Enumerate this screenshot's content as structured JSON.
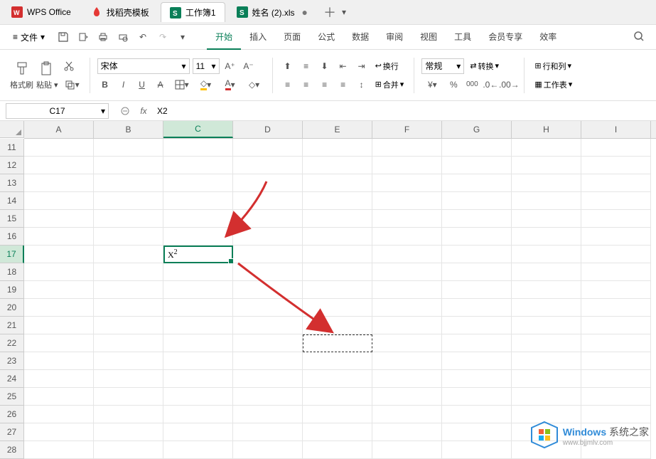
{
  "topTabs": {
    "t1": {
      "label": "WPS Office"
    },
    "t2": {
      "label": "找稻壳模板"
    },
    "t3": {
      "label": "工作簿1"
    },
    "t4": {
      "label": "姓名 (2).xls"
    }
  },
  "menuBar": {
    "file_label": "文件",
    "tabs": {
      "t1": "开始",
      "t2": "插入",
      "t3": "页面",
      "t4": "公式",
      "t5": "数据",
      "t6": "审阅",
      "t7": "视图",
      "t8": "工具",
      "t9": "会员专享",
      "t10": "效率"
    }
  },
  "ribbon": {
    "format_painter": "格式刷",
    "paste": "粘贴",
    "font_name": "宋体",
    "font_size": "11",
    "wrap_text": "换行",
    "merge": "合并",
    "number_format": "常规",
    "convert": "转换",
    "row_col": "行和列",
    "worksheet": "工作表"
  },
  "nameBox": {
    "value": "C17"
  },
  "formula": {
    "text": "X2"
  },
  "columns": [
    "A",
    "B",
    "C",
    "D",
    "E",
    "F",
    "G",
    "H",
    "I"
  ],
  "rowStart": 11,
  "rowEnd": 28,
  "activeCell": {
    "col": "C",
    "row": 17,
    "display": "X",
    "super": "2"
  },
  "dashCell": {
    "col": "E",
    "row": 22
  },
  "watermark": {
    "brand_colored": "Windows",
    "brand_rest": "系统之家",
    "url": "www.bjjmlv.com"
  }
}
